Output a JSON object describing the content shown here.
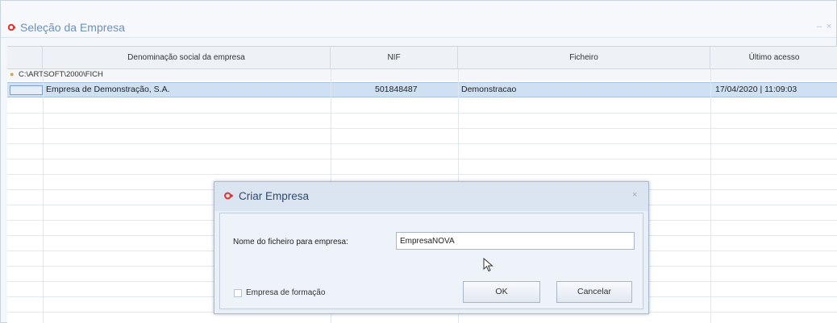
{
  "window": {
    "title": "Seleção da Empresa",
    "controls": [
      "–",
      "×"
    ]
  },
  "grid": {
    "columns": [
      "Denominação social da empresa",
      "NIF",
      "Ficheiro",
      "Último acesso"
    ],
    "group": "C:\\ARTSOFT\\2000\\FICH",
    "rows": [
      {
        "name": "Empresa de Demonstração, S.A.",
        "nif": "501848487",
        "file": "Demonstracao",
        "last_access": "17/04/2020 | 11:09:03"
      }
    ]
  },
  "dialog": {
    "title": "Criar Empresa",
    "close": "×",
    "field_label": "Nome do ficheiro para empresa:",
    "field_value": "EmpresaNOVA",
    "checkbox_label": "Empresa de formação",
    "checkbox_checked": false,
    "ok_label": "OK",
    "cancel_label": "Cancelar"
  },
  "colors": {
    "accent": "#6d8fbd",
    "selection": "#cfe0f3",
    "dialog_bg": "#e9eff6"
  }
}
